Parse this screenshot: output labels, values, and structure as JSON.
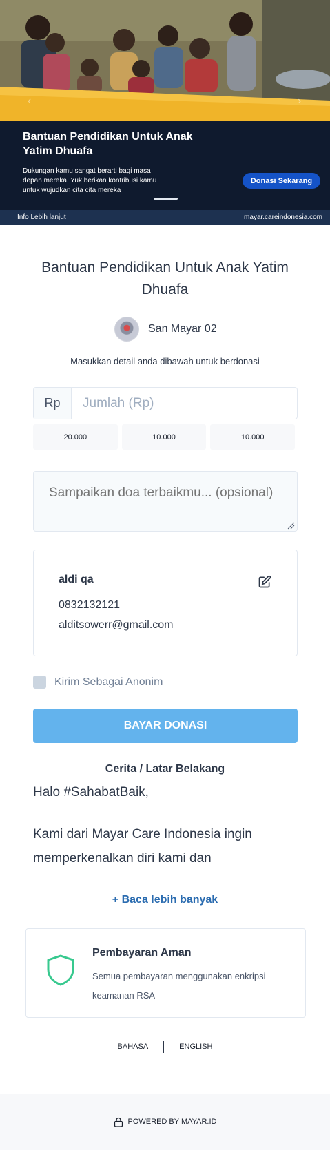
{
  "banner": {
    "title": "Bantuan Pendidikan Untuk Anak Yatim Dhuafa",
    "description": "Dukungan kamu sangat berarti bagi masa depan mereka. Yuk berikan kontribusi kamu untuk wujudkan cita cita mereka",
    "cta_label": "Donasi Sekarang",
    "footer_left": "Info Lebih lanjut",
    "footer_right": "mayar.careindonesia.com",
    "prev_icon": "chevron-left-icon",
    "next_icon": "chevron-right-icon",
    "accent_yellow": "#f6c343",
    "panel_color": "#0f1a2e"
  },
  "campaign": {
    "title": "Bantuan Pendidikan Untuk Anak Yatim Dhuafa",
    "creator_name": "San Mayar 02",
    "instruction": "Masukkan detail anda dibawah untuk berdonasi"
  },
  "form": {
    "currency_prefix": "Rp",
    "amount_placeholder": "Jumlah (Rp)",
    "presets": [
      "20.000",
      "10.000",
      "10.000"
    ],
    "prayer_placeholder": "Sampaikan doa terbaikmu... (opsional)",
    "user": {
      "name": "aldi qa",
      "phone": "0832132121",
      "email": "alditsowerr@gmail.com",
      "edit_icon": "edit-icon"
    },
    "anonymous_label": "Kirim Sebagai Anonim",
    "submit_label": "BAYAR DONASI",
    "submit_color": "#63b3ed"
  },
  "story": {
    "title": "Cerita / Latar Belakang",
    "paragraph1": "Halo #SahabatBaik,",
    "paragraph2": "Kami dari Mayar Care Indonesia ingin memperkenalkan diri kami dan",
    "read_more": "+ Baca lebih banyak"
  },
  "security": {
    "icon": "shield-icon",
    "title": "Pembayaran Aman",
    "description": "Semua pembayaran menggunakan enkripsi keamanan RSA",
    "icon_color": "#38c98f"
  },
  "language": {
    "left": "BAHASA",
    "right": "ENGLISH"
  },
  "footer": {
    "icon": "lock-icon",
    "label": "POWERED BY MAYAR.ID"
  }
}
